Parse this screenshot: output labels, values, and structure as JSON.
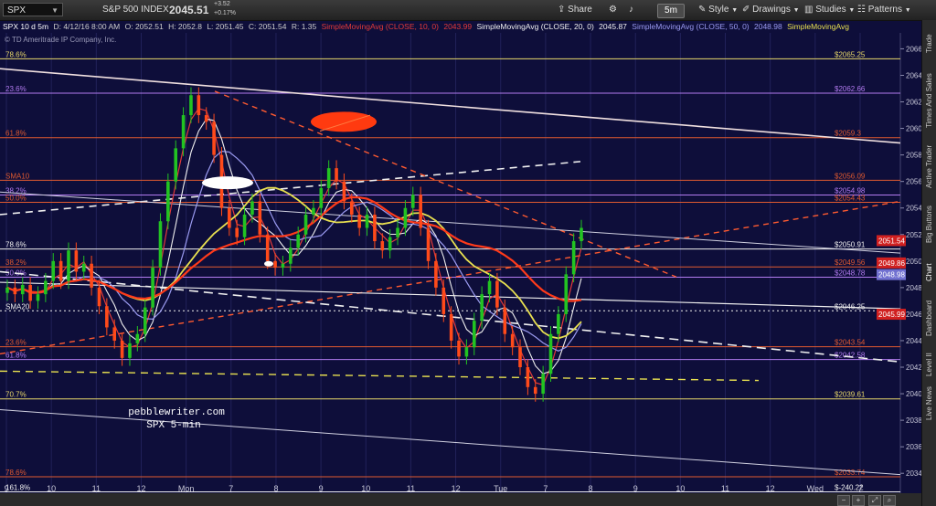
{
  "toolbar": {
    "symbol": "SPX",
    "symbol_desc": "S&P 500 INDEX",
    "last_price": "2045.51",
    "net_change": "+3.52",
    "pct_change": "+0.17%",
    "share_label": "Share",
    "interval_label": "5m",
    "style_label": "Style",
    "drawings_label": "Drawings",
    "studies_label": "Studies",
    "patterns_label": "Patterns"
  },
  "info_row": {
    "symbol_period": "SPX 10 d 5m",
    "date": "D: 4/12/16 8:00 AM",
    "open": "O: 2052.51",
    "high": "H: 2052.8",
    "low": "L: 2051.45",
    "close": "C: 2051.54",
    "range": "R: 1.35",
    "sma10_label": "SimpleMovingAvg (CLOSE, 10, 0)",
    "sma10_value": "2043.99",
    "sma20_label": "SimpleMovingAvg (CLOSE, 20, 0)",
    "sma20_value": "2045.87",
    "sma50_label": "SimpleMovingAvg (CLOSE, 50, 0)",
    "sma50_value": "2048.98",
    "sma100_label": "SimpleMovingAvg"
  },
  "copyright": "© TD Ameritrade IP Company, Inc.",
  "watermark": [
    "pebblewriter.com",
    "SPX 5-min"
  ],
  "sidebar_tabs": [
    "Trade",
    "Times And Sales",
    "Active Trader",
    "Big Buttons",
    "Chart",
    "Dashboard",
    "Level II",
    "Live News"
  ],
  "colors": {
    "background": "#0e0e3a",
    "price_up": "#22c322",
    "price_down": "#ff4a1a",
    "sma10": "#e33a3a",
    "sma20": "#f0f0f0",
    "sma50": "#9a9af0",
    "sma100": "#e8e050",
    "level_orange": "#e05a30",
    "level_violet": "#b27bf0",
    "level_gold": "#e8d86a"
  },
  "chart_data": {
    "type": "candlestick",
    "symbol": "SPX",
    "timeframe": "5m",
    "ylim": [
      2032.5,
      2067.2
    ],
    "y_ticks": [
      2034,
      2036,
      2038,
      2040,
      2042,
      2044,
      2046,
      2048,
      2050,
      2052,
      2054,
      2056,
      2058,
      2060,
      2062,
      2064,
      2066
    ],
    "x_tick_labels": [
      "9",
      "10",
      "11",
      "12",
      "Mon",
      "7",
      "8",
      "9",
      "10",
      "11",
      "12",
      "Tue",
      "7",
      "8",
      "9",
      "10",
      "11",
      "12",
      "Wed",
      "7"
    ],
    "price_levels": [
      {
        "label": "$2065.25",
        "value": 2065.25,
        "left_text": "78.6%",
        "style": "gold"
      },
      {
        "label": "$2062.66",
        "value": 2062.66,
        "left_text": "23.6%",
        "style": "violet"
      },
      {
        "label": "$2059.3",
        "value": 2059.3,
        "left_text": "61.8%",
        "style": "orange"
      },
      {
        "label": "$2056.09",
        "value": 2056.09,
        "left_text": "SMA10",
        "style": "orange"
      },
      {
        "label": "$2054.98",
        "value": 2054.98,
        "left_text": "38.2%",
        "style": "violet"
      },
      {
        "label": "$2054.43",
        "value": 2054.43,
        "left_text": "50.0%",
        "style": "orange"
      },
      {
        "label": "$2050.91",
        "value": 2050.91,
        "left_text": "78.6%",
        "style": "white"
      },
      {
        "label": "$2049.56",
        "value": 2049.56,
        "left_text": "38.2%",
        "style": "orange"
      },
      {
        "label": "$2048.78",
        "value": 2048.78,
        "left_text": "50.0%",
        "style": "violet"
      },
      {
        "label": "$2046.25",
        "value": 2046.25,
        "left_text": "SMA20",
        "style": "white"
      },
      {
        "label": "$2043.54",
        "value": 2043.54,
        "left_text": "23.6%",
        "style": "orange"
      },
      {
        "label": "$2042.58",
        "value": 2042.58,
        "left_text": "61.8%",
        "style": "violet"
      },
      {
        "label": "$2039.61",
        "value": 2039.61,
        "left_text": "70.7%",
        "style": "gold"
      },
      {
        "label": "$2033.74",
        "value": 2033.74,
        "left_text": "78.6%",
        "style": "orange"
      },
      {
        "label": "$-240.22",
        "value": 2032.6,
        "left_text": "161.8%",
        "style": "white"
      }
    ],
    "price_bubbles": [
      {
        "label": "2051.54",
        "value": 2051.54,
        "color": "#d02020"
      },
      {
        "label": "2049.86",
        "value": 2049.86,
        "color": "#d02020"
      },
      {
        "label": "2048.98",
        "value": 2048.98,
        "color": "#7070d0"
      },
      {
        "label": "2045.99",
        "value": 2045.99,
        "color": "#d02020"
      }
    ],
    "close_path": [
      2048.0,
      2047.5,
      2048.2,
      2047.0,
      2047.5,
      2048.5,
      2050.0,
      2048.5,
      2050.8,
      2049.2,
      2049.8,
      2048.0,
      2046.6,
      2045.0,
      2044.0,
      2042.7,
      2043.8,
      2044.5,
      2046.5,
      2049.5,
      2053.0,
      2056.0,
      2058.5,
      2061.0,
      2062.5,
      2061.0,
      2060.5,
      2058.0,
      2054.0,
      2052.5,
      2051.8,
      2053.5,
      2054.5,
      2052.0,
      2050.0,
      2049.5,
      2049.8,
      2051.0,
      2052.0,
      2053.5,
      2054.0,
      2055.5,
      2057.0,
      2056.0,
      2054.5,
      2053.5,
      2052.5,
      2053.5,
      2051.5,
      2050.8,
      2051.8,
      2052.5,
      2054.0,
      2055.0,
      2052.5,
      2050.0,
      2048.0,
      2046.0,
      2044.0,
      2042.8,
      2043.5,
      2045.5,
      2047.5,
      2048.5,
      2046.5,
      2044.5,
      2043.5,
      2042.0,
      2040.5,
      2040.0,
      2041.5,
      2044.5,
      2046.0,
      2049.0,
      2051.5,
      2052.5
    ]
  }
}
